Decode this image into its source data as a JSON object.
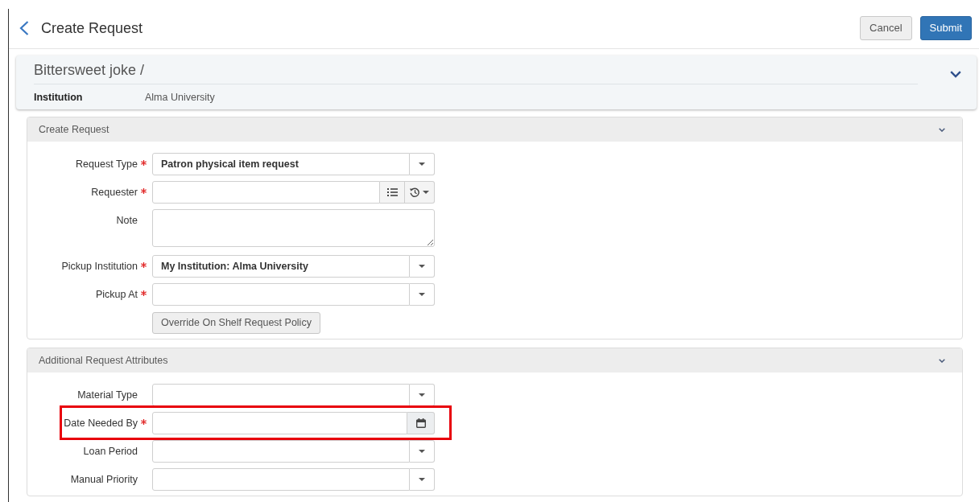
{
  "header": {
    "title": "Create Request",
    "buttons": [
      {
        "label": "Cancel",
        "kind": "secondary"
      },
      {
        "label": "Submit",
        "kind": "primary"
      }
    ]
  },
  "record": {
    "title": "Bittersweet joke /",
    "fields": [
      {
        "label": "Institution",
        "value": "Alma University"
      }
    ]
  },
  "sections": [
    {
      "title": "Create Request",
      "fields": [
        {
          "label": "Request Type",
          "kind": "select",
          "required": true,
          "highlighted": false,
          "value": "Patron physical item request"
        },
        {
          "label": "Requester",
          "kind": "lookup",
          "required": true,
          "highlighted": false
        },
        {
          "label": "Note",
          "kind": "textarea",
          "required": false,
          "highlighted": false
        },
        {
          "label": "Pickup Institution",
          "kind": "select",
          "required": true,
          "highlighted": false,
          "value": "My Institution: Alma University"
        },
        {
          "label": "Pickup At",
          "kind": "select",
          "required": true,
          "highlighted": false
        }
      ],
      "buttons": [
        {
          "label": "Override On Shelf Request Policy"
        }
      ]
    },
    {
      "title": "Additional Request Attributes",
      "fields": [
        {
          "label": "Material Type",
          "kind": "select",
          "required": false,
          "highlighted": false
        },
        {
          "label": "Date Needed By",
          "kind": "date",
          "required": true,
          "highlighted": true
        },
        {
          "label": "Loan Period",
          "kind": "select",
          "required": false,
          "highlighted": false
        },
        {
          "label": "Manual Priority",
          "kind": "select",
          "required": false,
          "highlighted": false
        }
      ]
    }
  ]
}
